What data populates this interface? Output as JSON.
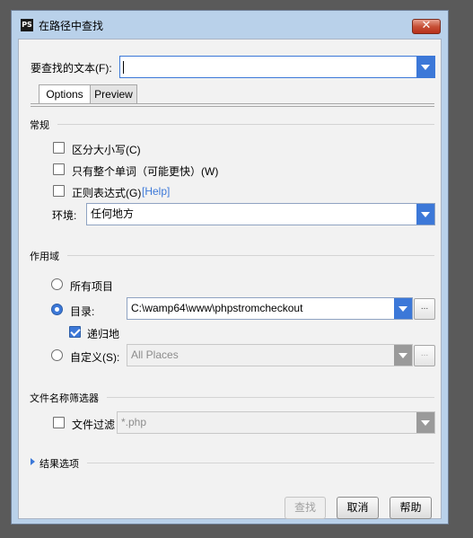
{
  "window": {
    "title": "在路径中查找",
    "app_icon_text": "PS",
    "close_label": "✕"
  },
  "find_field": {
    "label": "要查找的文本(F):",
    "value": ""
  },
  "tabs": [
    {
      "label": "Options",
      "active": true
    },
    {
      "label": "Preview",
      "active": false
    }
  ],
  "general": {
    "section_label": "常规",
    "match_case": {
      "label": "区分大小写(C)",
      "checked": false
    },
    "whole_words": {
      "label": "只有整个单词（可能更快）(W)",
      "checked": false
    },
    "regex": {
      "label": "正则表达式(G)",
      "checked": false,
      "help_label": "[Help]"
    },
    "context": {
      "label": "环境:",
      "value": "任何地方"
    }
  },
  "scope": {
    "section_label": "作用域",
    "whole_project": {
      "label": "所有项目",
      "selected": false
    },
    "directory": {
      "label": "目录:",
      "selected": true,
      "value": "C:\\wamp64\\www\\phpstromcheckout",
      "browse": "..."
    },
    "recursive": {
      "label": "递归地",
      "checked": true
    },
    "custom": {
      "label": "自定义(S):",
      "selected": false,
      "value": "All Places",
      "browse": "..."
    }
  },
  "file_filter": {
    "section_label": "文件名称筛选器",
    "mask": {
      "label": "文件过滤",
      "checked": false,
      "value": "*.php"
    }
  },
  "result_options": {
    "label": "结果选项"
  },
  "buttons": {
    "find": "查找",
    "cancel": "取消",
    "help": "帮助"
  },
  "colors": {
    "accent": "#3c78d8",
    "title_bar": "#b9d1ea",
    "close": "#c75138"
  }
}
